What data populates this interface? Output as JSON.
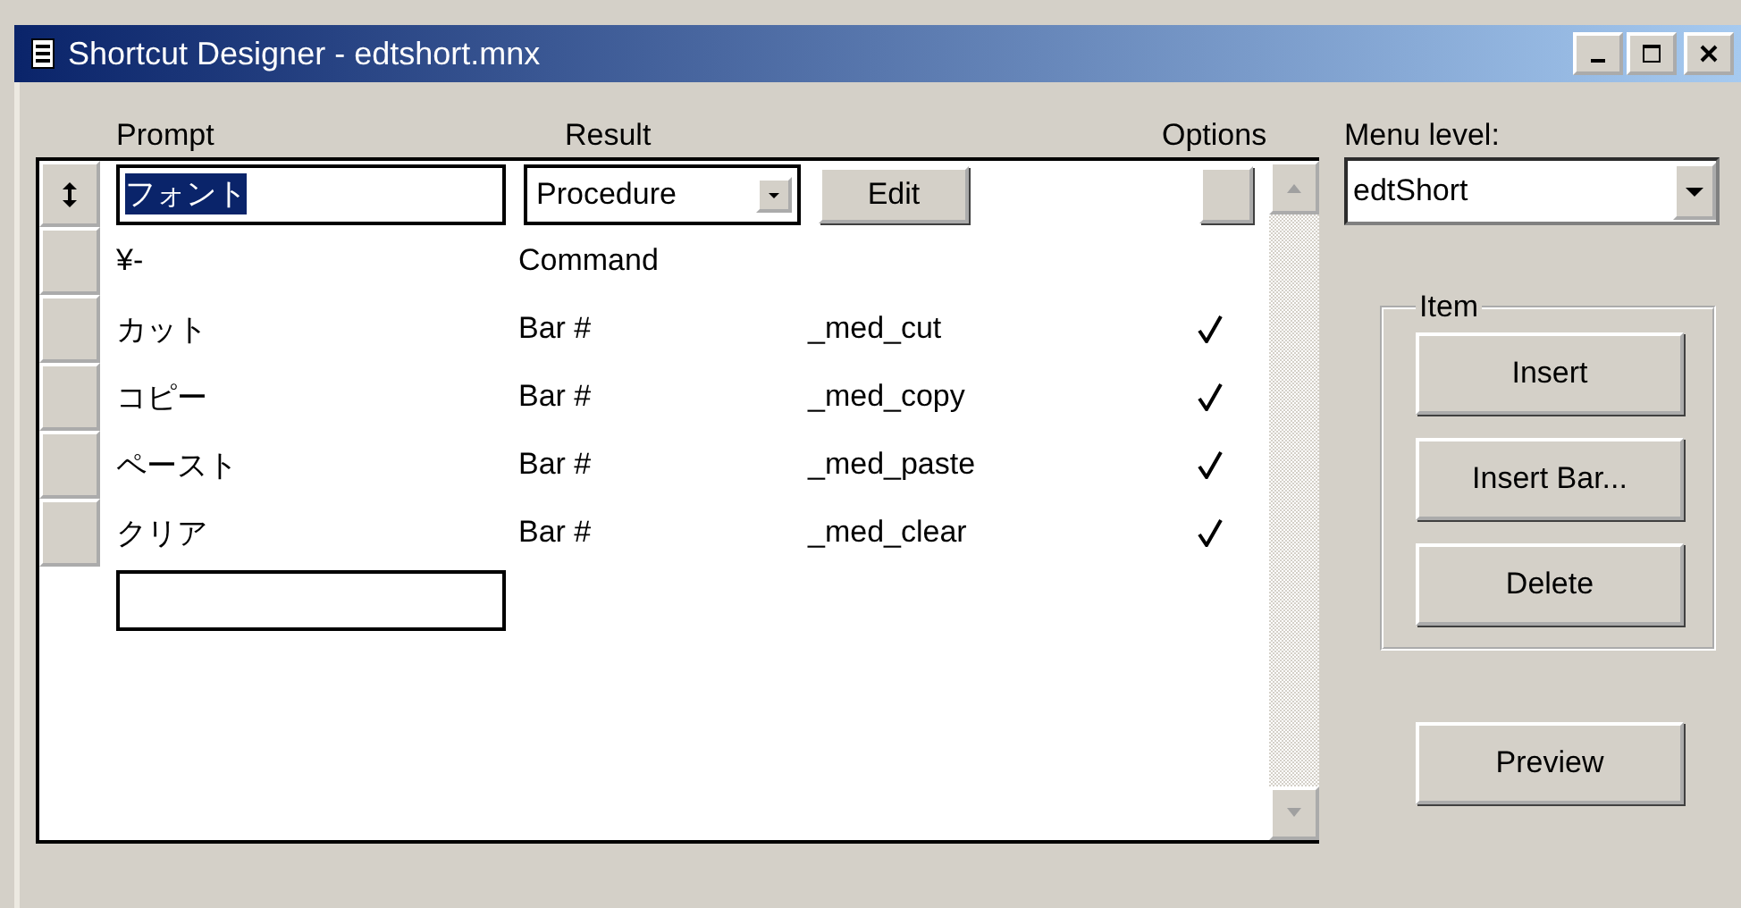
{
  "window": {
    "title": "Shortcut Designer - edtshort.mnx"
  },
  "columns": {
    "prompt": "Prompt",
    "result": "Result",
    "options": "Options"
  },
  "rows": [
    {
      "kind": "editing",
      "prompt": "フォント",
      "result": "Procedure",
      "action": "Edit"
    },
    {
      "kind": "plain",
      "prompt": "¥-",
      "result": "Command",
      "checked": false
    },
    {
      "kind": "plain",
      "prompt": "カット",
      "result": "Bar #",
      "name": "_med_cut",
      "checked": true
    },
    {
      "kind": "plain",
      "prompt": "コピー",
      "result": "Bar #",
      "name": "_med_copy",
      "checked": true
    },
    {
      "kind": "plain",
      "prompt": "ペースト",
      "result": "Bar #",
      "name": "_med_paste",
      "checked": true
    },
    {
      "kind": "plain",
      "prompt": "クリア",
      "result": "Bar #",
      "name": "_med_clear",
      "checked": true
    }
  ],
  "menu_level": {
    "label": "Menu level:",
    "value": "edtShort"
  },
  "item_group": {
    "title": "Item",
    "buttons": [
      "Insert",
      "Insert Bar...",
      "Delete"
    ]
  },
  "preview_button": "Preview"
}
